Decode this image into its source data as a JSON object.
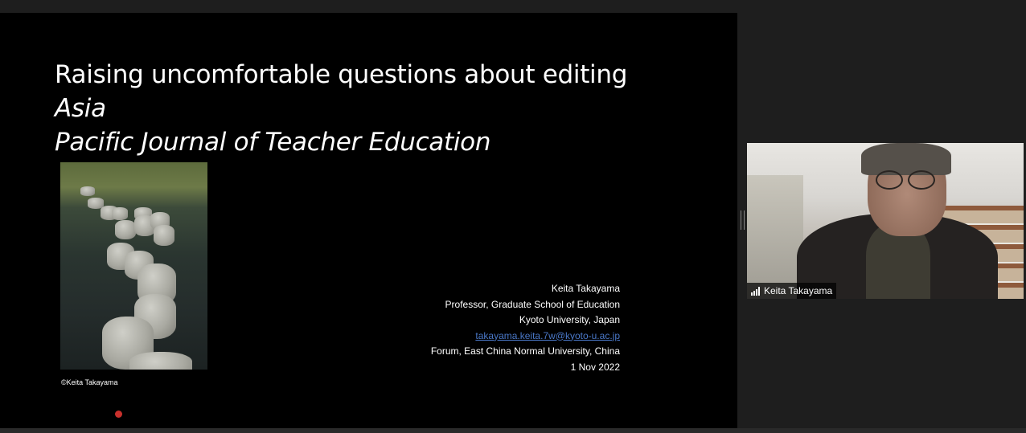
{
  "slide": {
    "title_plain": "Raising uncomfortable questions about editing ",
    "title_italic_1": "Asia",
    "title_italic_2": "Pacific Journal of Teacher Education",
    "photo_credit": "©Keita Takayama",
    "presenter": {
      "name": "Keita Takayama",
      "position": "Professor, Graduate School of Education",
      "affiliation": "Kyoto University, Japan",
      "email": "takayama.keita.7w@kyoto-u.ac.jp",
      "event": "Forum, East China Normal University, China",
      "date": "1 Nov 2022"
    }
  },
  "video": {
    "participant_name": "Keita Takayama",
    "signal_icon": "signal-bars-icon"
  },
  "colors": {
    "slide_bg": "#000000",
    "app_bg": "#1e1e1e",
    "link": "#4a78c8"
  }
}
